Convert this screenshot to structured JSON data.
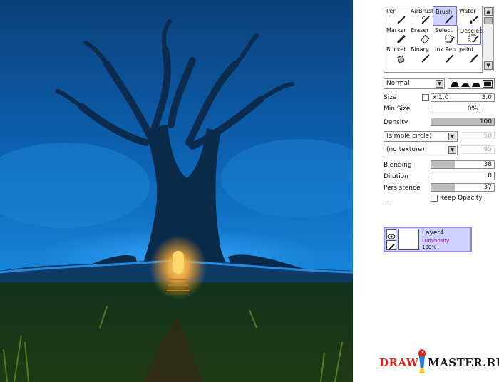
{
  "tools": [
    {
      "label": "Pen",
      "icon": "pen-icon"
    },
    {
      "label": "AirBrush",
      "icon": "airbrush-icon"
    },
    {
      "label": "Brush",
      "icon": "brush-icon"
    },
    {
      "label": "Water",
      "icon": "water-icon"
    },
    {
      "label": "Marker",
      "icon": "marker-icon"
    },
    {
      "label": "Eraser",
      "icon": "eraser-icon"
    },
    {
      "label": "Select",
      "icon": "select-icon"
    },
    {
      "label": "Deselect",
      "icon": "deselect-icon"
    },
    {
      "label": "Bucket",
      "icon": "bucket-icon"
    },
    {
      "label": "Binary",
      "icon": "binary-icon"
    },
    {
      "label": "Ink Pen",
      "icon": "ink-pen-icon"
    },
    {
      "label": "paint",
      "icon": "paint-icon"
    }
  ],
  "selected_tool": "Brush",
  "blend_mode": "Normal",
  "size": {
    "label": "Size",
    "multiplier": "x 1.0",
    "value": "3.0"
  },
  "min_size": {
    "label": "Min Size",
    "value": "0%"
  },
  "density": {
    "label": "Density",
    "value": "100"
  },
  "brush_shape": {
    "value": "(simple circle)",
    "number": "50"
  },
  "texture": {
    "value": "(no texture)",
    "number": "95"
  },
  "blending": {
    "label": "Blending",
    "value": "38",
    "level": 0.38
  },
  "dilution": {
    "label": "Dilution",
    "value": "0",
    "level": 0.0
  },
  "persistence": {
    "label": "Persistence",
    "value": "37",
    "level": 0.37
  },
  "keep_opacity": {
    "label": "Keep Opacity",
    "checked": false
  },
  "layer": {
    "name": "Layer4",
    "mode": "Luminosity",
    "opacity": "100%"
  },
  "watermark": {
    "part1": "DRAW",
    "part2": "MASTER.RU"
  },
  "colors": {
    "selection": "#cfd0ff",
    "accent": "#6d6dd8",
    "layer_mode": "#8b1fa0",
    "logo_red": "#d8231c"
  }
}
